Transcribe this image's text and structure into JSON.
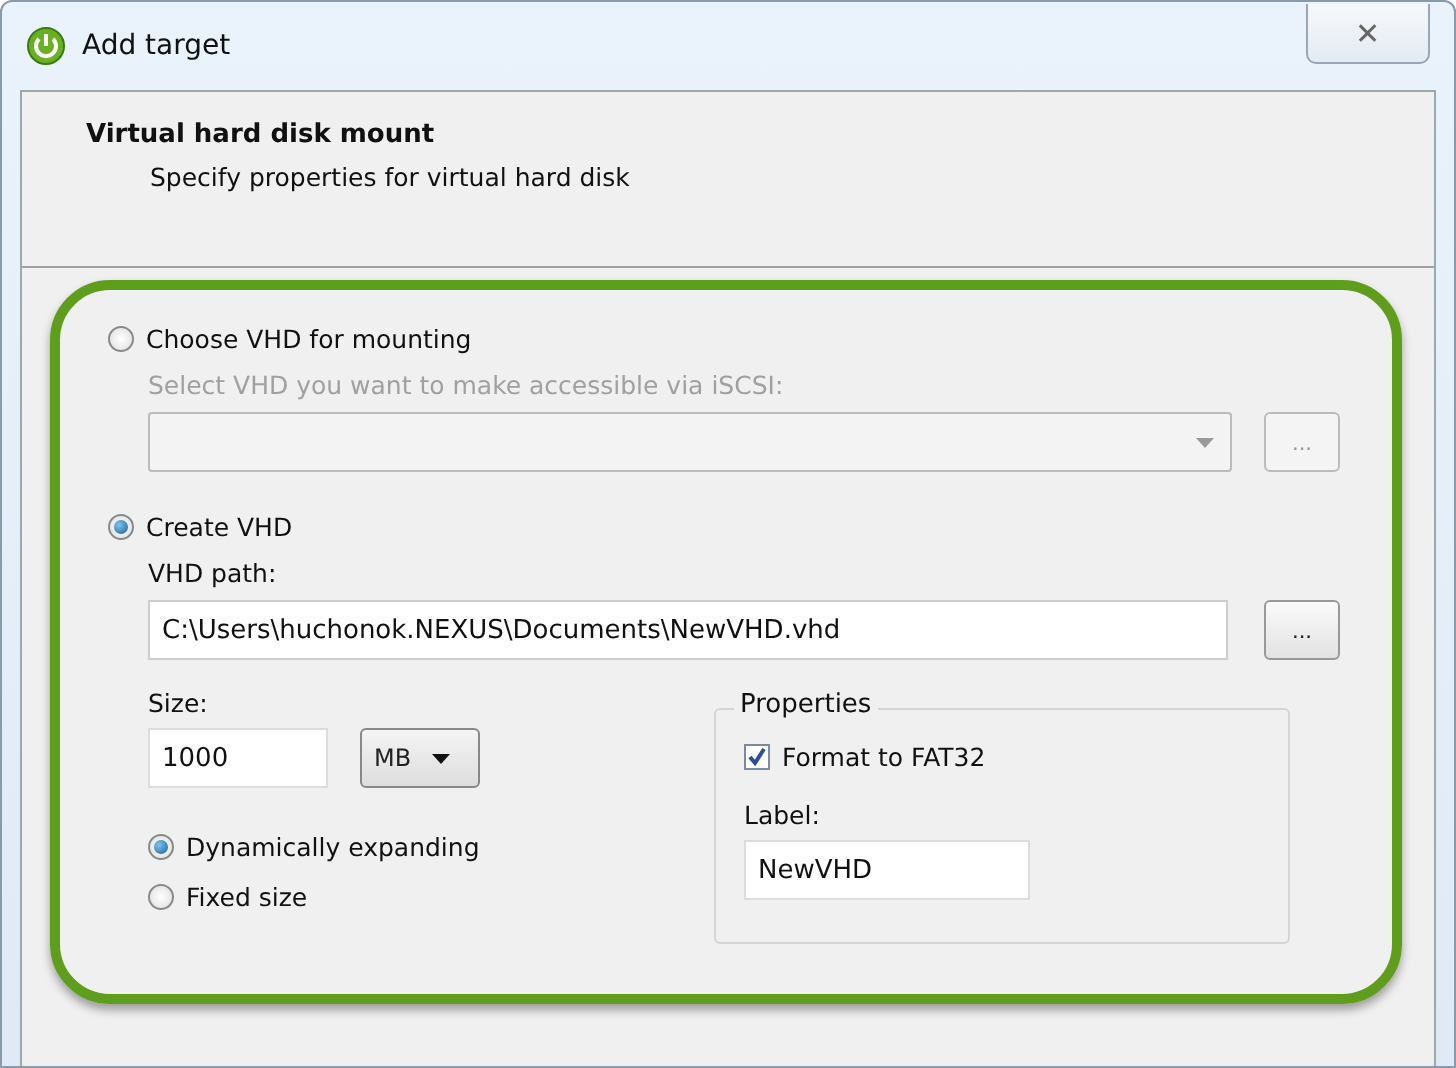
{
  "window": {
    "title": "Add target",
    "close_label": "✕"
  },
  "header": {
    "title": "Virtual hard disk mount",
    "subtitle": "Specify properties for virtual hard disk"
  },
  "choose_vhd": {
    "label": "Choose VHD for mounting",
    "selected": false,
    "hint": "Select VHD you want to make accessible via iSCSI:",
    "disabled": true,
    "browse_label": "..."
  },
  "create_vhd": {
    "label": "Create VHD",
    "selected": true,
    "path_label": "VHD path:",
    "path_value": "C:\\Users\\huchonok.NEXUS\\Documents\\NewVHD.vhd",
    "browse_label": "..."
  },
  "size": {
    "label": "Size:",
    "value": "1000",
    "unit": "MB"
  },
  "disk_types": [
    {
      "label": "Dynamically expanding",
      "selected": true
    },
    {
      "label": "Fixed size",
      "selected": false
    }
  ],
  "properties": {
    "title": "Properties",
    "format_label": "Format to FAT32",
    "format_checked": true,
    "label_label": "Label:",
    "label_value": "NewVHD"
  }
}
